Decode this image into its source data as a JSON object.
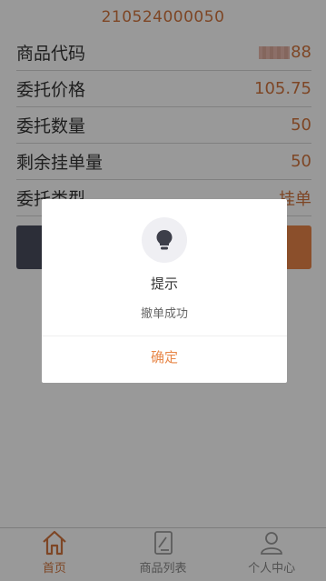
{
  "order": {
    "id": "210524000050"
  },
  "fields": [
    {
      "label": "商品代码",
      "value": "88"
    },
    {
      "label": "委托价格",
      "value": "105.75"
    },
    {
      "label": "委托数量",
      "value": "50"
    },
    {
      "label": "剩余挂单量",
      "value": "50"
    },
    {
      "label": "委托类型",
      "value": "挂单"
    }
  ],
  "dialog": {
    "title": "提示",
    "message": "撤单成功",
    "confirm": "确定",
    "icon": "lightbulb-icon"
  },
  "tabbar": {
    "items": [
      {
        "label": "首页",
        "icon": "home-icon",
        "active": true
      },
      {
        "label": "商品列表",
        "icon": "list-icon",
        "active": false
      },
      {
        "label": "个人中心",
        "icon": "user-icon",
        "active": false
      }
    ]
  },
  "colors": {
    "accent": "#d2763f",
    "dark_button": "#4a4e5e",
    "orange_button": "#e88448",
    "overlay": "rgba(0,0,0,0.4)"
  }
}
